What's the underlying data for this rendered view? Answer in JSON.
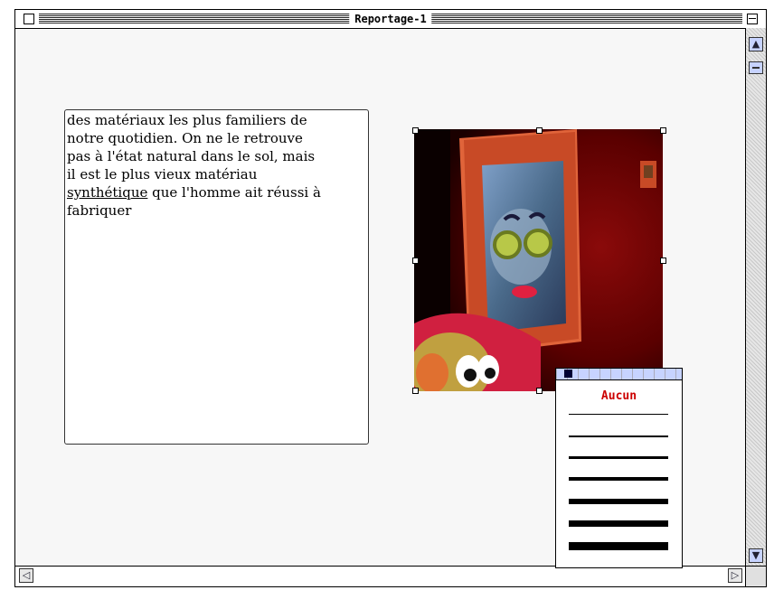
{
  "window": {
    "title": "Reportage-1"
  },
  "text_box": {
    "lines": [
      "des matériaux les plus familiers de",
      "notre quotidien. On ne le retrouve",
      "pas à l'état natural dans le sol, mais",
      "il est le plus vieux matériau"
    ],
    "underlined_word": "synthétique",
    "line5_rest": " que l'homme ait réussi à",
    "line6": "fabriquer"
  },
  "line_palette": {
    "title": "Aucun",
    "options": [
      "hairline",
      "1pt",
      "2pt",
      "3pt",
      "4pt",
      "6pt",
      "8pt"
    ]
  },
  "colors": {
    "accent": "#cc0000",
    "scroll_button": "#c7d3ff"
  }
}
